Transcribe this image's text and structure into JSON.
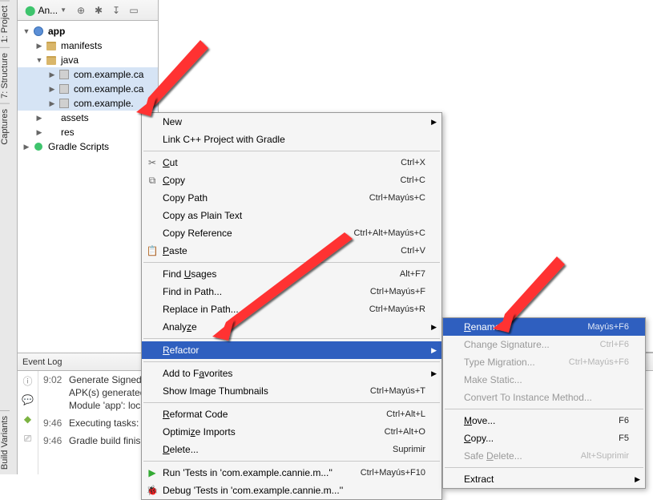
{
  "left_rail": {
    "tabs": [
      "1: Project",
      "7: Structure",
      "Captures",
      "Build Variants"
    ]
  },
  "toolbar": {
    "view_label": "An..."
  },
  "tree": {
    "app": "app",
    "manifests": "manifests",
    "java": "java",
    "pkg1": "com.example.ca",
    "pkg2": "com.example.ca",
    "pkg3": "com.example.",
    "assets": "assets",
    "res": "res",
    "gradle": "Gradle Scripts"
  },
  "menu": {
    "new": "New",
    "link": "Link C++ Project with Gradle",
    "cut": "Cut",
    "copy": "Copy",
    "copy_path": "Copy Path",
    "copy_plain": "Copy as Plain Text",
    "copy_ref": "Copy Reference",
    "paste": "Paste",
    "find_usages": "Find Usages",
    "find_in_path": "Find in Path...",
    "replace_in_path": "Replace in Path...",
    "analyze": "Analyze",
    "refactor": "Refactor",
    "add_fav": "Add to Favorites",
    "show_thumbs": "Show Image Thumbnails",
    "reformat": "Reformat Code",
    "optimize": "Optimize Imports",
    "delete": "Delete...",
    "run": "Run 'Tests in 'com.example.cannie.m...''",
    "debug": "Debug 'Tests in 'com.example.cannie.m...''",
    "sc_cut": "Ctrl+X",
    "sc_copy": "Ctrl+C",
    "sc_copy_path": "Ctrl+Mayús+C",
    "sc_copy_ref": "Ctrl+Alt+Mayús+C",
    "sc_paste": "Ctrl+V",
    "sc_find_usages": "Alt+F7",
    "sc_find_in_path": "Ctrl+Mayús+F",
    "sc_replace": "Ctrl+Mayús+R",
    "sc_thumbs": "Ctrl+Mayús+T",
    "sc_reformat": "Ctrl+Alt+L",
    "sc_optimize": "Ctrl+Alt+O",
    "sc_delete": "Suprimir",
    "sc_run": "Ctrl+Mayús+F10"
  },
  "submenu": {
    "rename": "Rename...",
    "sc_rename": "Mayús+F6",
    "change_sig": "Change Signature...",
    "sc_change_sig": "Ctrl+F6",
    "type_mig": "Type Migration...",
    "sc_type_mig": "Ctrl+Mayús+F6",
    "make_static": "Make Static...",
    "convert": "Convert To Instance Method...",
    "move": "Move...",
    "sc_move": "F6",
    "copy": "Copy...",
    "sc_copy": "F5",
    "safe_del": "Safe Delete...",
    "sc_safe_del": "Alt+Suprimir",
    "extract": "Extract"
  },
  "event_log": {
    "title": "Event Log",
    "rows": [
      {
        "time": "9:02",
        "text": "Generate Signed A"
      },
      {
        "time": "",
        "text": "APK(s) generated"
      },
      {
        "time": "",
        "text": "Module 'app': loc"
      },
      {
        "time": "9:46",
        "text": "Executing tasks: ["
      },
      {
        "time": "9:46",
        "text": "Gradle build finisl"
      }
    ]
  }
}
